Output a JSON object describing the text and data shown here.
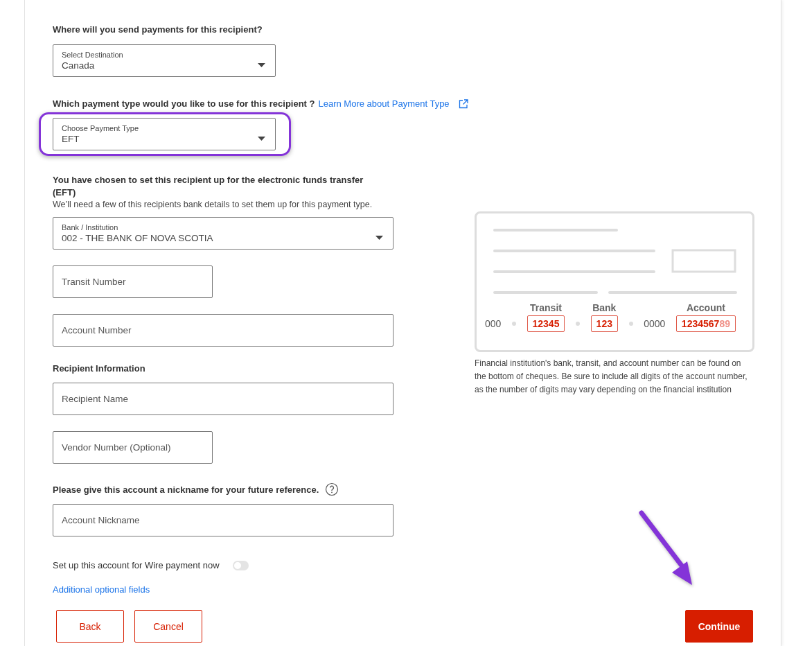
{
  "destination": {
    "question": "Where will you send payments for this recipient?",
    "label": "Select Destination",
    "value": "Canada"
  },
  "payment_type": {
    "question": "Which payment type would you like to use for this recipient ?",
    "link": "Learn More about Payment Type",
    "label": "Choose Payment Type",
    "value": "EFT",
    "highlighted": true
  },
  "eft": {
    "heading": "You have chosen to set this recipient up for the electronic funds transfer (EFT)",
    "note": "We’ll need a few of this recipients bank details to set them up for this payment type."
  },
  "bank": {
    "label": "Bank / Institution",
    "value": "002 - THE BANK OF NOVA SCOTIA"
  },
  "bank_fields": [
    {
      "placeholder": "Transit Number",
      "kind": "short"
    },
    {
      "placeholder": "Account Number",
      "kind": "long"
    }
  ],
  "recipient": {
    "heading": "Recipient Information",
    "fields": [
      {
        "placeholder": "Recipient Name",
        "kind": "long"
      },
      {
        "placeholder": "Vendor Number (Optional)",
        "kind": "short"
      }
    ]
  },
  "nickname": {
    "question": "Please give this account a nickname for your future reference.",
    "placeholder": "Account Nickname"
  },
  "wire": {
    "label": "Set up this account for Wire payment now",
    "on": false
  },
  "optional_link": "Additional optional fields",
  "cheque": {
    "plain_start": "000",
    "transit_label": "Transit",
    "transit": "12345",
    "bank_label": "Bank",
    "bank": "123",
    "plain_middle": "0000",
    "account_label": "Account",
    "account": "1234567",
    "account_faded": "89"
  },
  "cheque_note": "Financial institution's bank, transit, and account number can be found on the bottom of cheques. Be sure to include all digits of the account number, as the number of digits may vary depending on the financial institution",
  "buttons": [
    {
      "label": "Back",
      "kind": "outline"
    },
    {
      "label": "Cancel",
      "kind": "outline"
    },
    {
      "label": "Continue",
      "kind": "primary"
    }
  ],
  "annotations": [
    {
      "kind": "arrow"
    }
  ]
}
